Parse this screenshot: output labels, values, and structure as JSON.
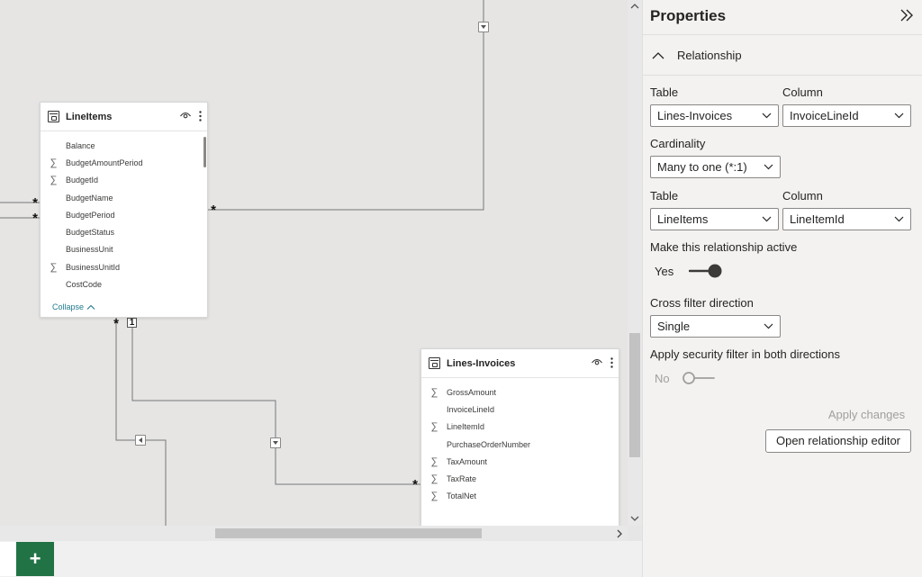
{
  "canvas": {
    "tables": [
      {
        "title": "LineItems",
        "fields": [
          {
            "name": "Balance",
            "sigma": false
          },
          {
            "name": "BudgetAmountPeriod",
            "sigma": true
          },
          {
            "name": "BudgetId",
            "sigma": true
          },
          {
            "name": "BudgetName",
            "sigma": false
          },
          {
            "name": "BudgetPeriod",
            "sigma": false
          },
          {
            "name": "BudgetStatus",
            "sigma": false
          },
          {
            "name": "BusinessUnit",
            "sigma": false
          },
          {
            "name": "BusinessUnitId",
            "sigma": true
          },
          {
            "name": "CostCode",
            "sigma": false
          }
        ],
        "collapse_label": "Collapse"
      },
      {
        "title": "Lines-Invoices",
        "fields": [
          {
            "name": "GrossAmount",
            "sigma": true
          },
          {
            "name": "InvoiceLineId",
            "sigma": false
          },
          {
            "name": "LineItemId",
            "sigma": true
          },
          {
            "name": "PurchaseOrderNumber",
            "sigma": false
          },
          {
            "name": "TaxAmount",
            "sigma": true
          },
          {
            "name": "TaxRate",
            "sigma": true
          },
          {
            "name": "TotalNet",
            "sigma": true
          }
        ]
      }
    ],
    "markers": {
      "many": "*",
      "one": "1"
    }
  },
  "bottom": {
    "add_page_label": "+"
  },
  "panel": {
    "title": "Properties",
    "section": "Relationship",
    "table_label": "Table",
    "column_label": "Column",
    "table1": "Lines-Invoices",
    "column1": "InvoiceLineId",
    "cardinality_label": "Cardinality",
    "cardinality": "Many to one (*:1)",
    "table2": "LineItems",
    "column2": "LineItemId",
    "active_label": "Make this relationship active",
    "active_value": "Yes",
    "cross_filter_label": "Cross filter direction",
    "cross_filter": "Single",
    "security_label": "Apply security filter in both directions",
    "security_value": "No",
    "apply_label": "Apply changes",
    "open_editor_label": "Open relationship editor"
  },
  "colors": {
    "accent_green": "#217346",
    "link_teal": "#217b8c"
  }
}
